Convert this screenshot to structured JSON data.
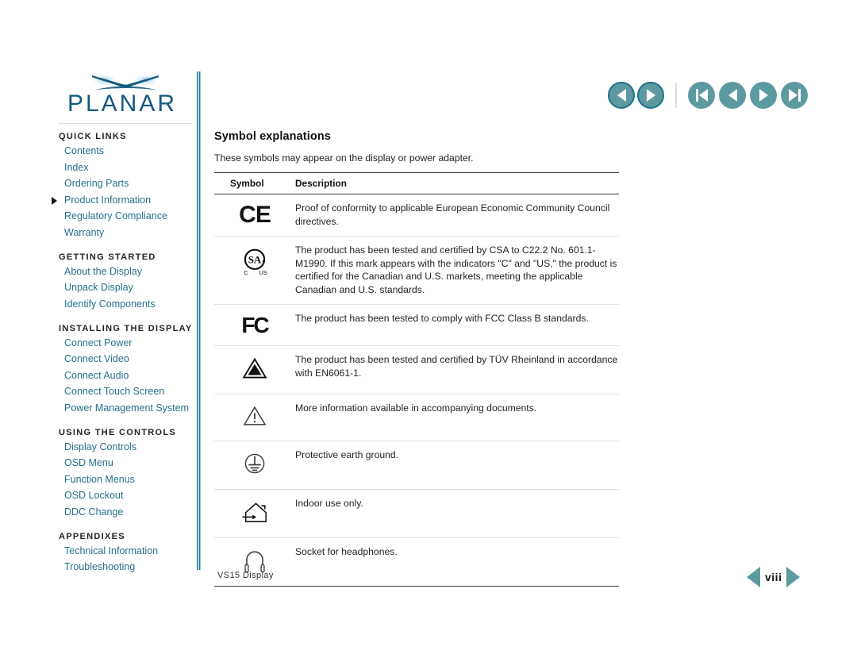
{
  "brand": {
    "name": "PLANAR",
    "logo_mark": "swoosh-mark"
  },
  "topnav": {
    "buttons": [
      {
        "name": "back-button",
        "icon": "arrow-left-icon"
      },
      {
        "name": "forward-button",
        "icon": "arrow-right-icon"
      },
      {
        "name": "first-page-button",
        "icon": "skip-to-start-icon"
      },
      {
        "name": "previous-page-button",
        "icon": "triangle-left-icon"
      },
      {
        "name": "next-page-button",
        "icon": "triangle-right-icon"
      },
      {
        "name": "last-page-button",
        "icon": "skip-to-end-icon"
      }
    ]
  },
  "sidebar": {
    "sections": [
      {
        "title": "QUICK LINKS",
        "items": [
          {
            "label": "Contents",
            "active": false
          },
          {
            "label": "Index",
            "active": false
          },
          {
            "label": "Ordering Parts",
            "active": false
          },
          {
            "label": "Product Information",
            "active": true
          },
          {
            "label": "Regulatory Compliance",
            "active": false
          },
          {
            "label": "Warranty",
            "active": false
          }
        ]
      },
      {
        "title": "GETTING STARTED",
        "items": [
          {
            "label": "About the Display",
            "active": false
          },
          {
            "label": "Unpack Display",
            "active": false
          },
          {
            "label": "Identify Components",
            "active": false
          }
        ]
      },
      {
        "title": "INSTALLING THE DISPLAY",
        "items": [
          {
            "label": "Connect Power",
            "active": false
          },
          {
            "label": "Connect Video",
            "active": false
          },
          {
            "label": "Connect Audio",
            "active": false
          },
          {
            "label": "Connect Touch Screen",
            "active": false
          },
          {
            "label": "Power Management System",
            "active": false
          }
        ]
      },
      {
        "title": "USING THE CONTROLS",
        "items": [
          {
            "label": "Display Controls",
            "active": false
          },
          {
            "label": "OSD Menu",
            "active": false
          },
          {
            "label": "Function Menus",
            "active": false
          },
          {
            "label": "OSD Lockout",
            "active": false
          },
          {
            "label": "DDC Change",
            "active": false
          }
        ]
      },
      {
        "title": "APPENDIXES",
        "items": [
          {
            "label": "Technical Information",
            "active": false
          },
          {
            "label": "Troubleshooting",
            "active": false
          }
        ]
      }
    ]
  },
  "main": {
    "title": "Symbol explanations",
    "intro": "These symbols may appear on the display or power adapter.",
    "table": {
      "columns": [
        "Symbol",
        "Description"
      ],
      "rows": [
        {
          "symbol_name": "ce-mark-icon",
          "symbol_text": "CE",
          "description": "Proof of conformity to applicable European Economic Community Council directives."
        },
        {
          "symbol_name": "csa-mark-icon",
          "symbol_text": "CSA",
          "description": "The product has been tested and certified by CSA to C22.2 No. 601.1-M1990. If this mark appears with the indicators \"C\" and \"US,\" the product is certified for the Canadian and U.S. markets, meeting the applicable Canadian and U.S. standards."
        },
        {
          "symbol_name": "fcc-mark-icon",
          "symbol_text": "FC",
          "description": "The product has been tested to comply with FCC Class B standards."
        },
        {
          "symbol_name": "tuv-mark-icon",
          "symbol_text": "",
          "description": "The product has been tested and certified by TÜV Rheinland in accordance with EN6061-1."
        },
        {
          "symbol_name": "warning-triangle-icon",
          "symbol_text": "",
          "description": "More information available in accompanying documents."
        },
        {
          "symbol_name": "protective-earth-ground-icon",
          "symbol_text": "",
          "description": "Protective earth ground."
        },
        {
          "symbol_name": "indoor-use-only-icon",
          "symbol_text": "",
          "description": "Indoor use only."
        },
        {
          "symbol_name": "headphones-icon",
          "symbol_text": "",
          "description": "Socket for headphones."
        }
      ]
    }
  },
  "footer": {
    "document_label": "VS15 Display",
    "page_number": "viii",
    "prev_icon": "triangle-left-icon",
    "next_icon": "triangle-right-icon"
  },
  "colors": {
    "teal_button": "#5d9aa0",
    "teal_button_border": "#1d7187",
    "link": "#2a6f86",
    "logo": "#14597f",
    "rule_dark": "#3a3a3a",
    "rule_light": "#e2e2e2"
  }
}
